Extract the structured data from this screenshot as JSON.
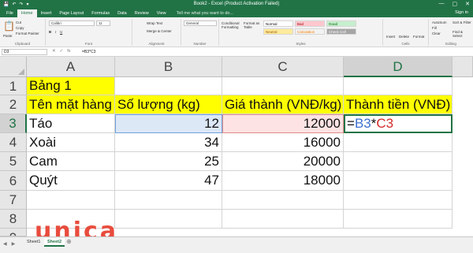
{
  "window": {
    "title": "Book2 - Excel (Product Activation Failed)",
    "qat": [
      "💾",
      "↶",
      "↷",
      "▾"
    ],
    "controls": [
      "—",
      "▢",
      "✕"
    ]
  },
  "ribbon_tabs": [
    "File",
    "Home",
    "Insert",
    "Page Layout",
    "Formulas",
    "Data",
    "Review",
    "View"
  ],
  "active_tab": "Home",
  "tell_me": "Tell me what you want to do...",
  "sign_in": "Sign in",
  "ribbon": {
    "clipboard": {
      "paste": "Paste",
      "cut": "Cut",
      "copy": "Copy",
      "painter": "Format Painter",
      "label": "Clipboard"
    },
    "font": {
      "name": "Calibri",
      "size": "11",
      "label": "Font"
    },
    "alignment": {
      "wrap": "Wrap Text",
      "merge": "Merge & Center",
      "label": "Alignment"
    },
    "number": {
      "format": "General",
      "label": "Number"
    },
    "styles": {
      "conditional": "Conditional Formatting",
      "format_table": "Format as Table",
      "normal": "Normal",
      "bad": "Bad",
      "good": "Good",
      "neutral": "Neutral",
      "calculation": "Calculation",
      "check_cell": "Check Cell",
      "label": "Styles"
    },
    "cells": {
      "insert": "Insert",
      "delete": "Delete",
      "format": "Format",
      "label": "Cells"
    },
    "editing": {
      "autosum": "AutoSum",
      "fill": "Fill",
      "clear": "Clear",
      "sort": "Sort & Filter",
      "find": "Find & Select",
      "label": "Editing"
    }
  },
  "formula_bar": {
    "name_box": "D3",
    "icons": [
      "✕",
      "✓",
      "fx"
    ],
    "formula": "=B3*C3"
  },
  "columns": [
    "A",
    "B",
    "C",
    "D"
  ],
  "rows": [
    "1",
    "2",
    "3",
    "4",
    "5",
    "6",
    "7",
    "8",
    "9"
  ],
  "cells": {
    "A1": "Bảng 1",
    "A2": "Tên mặt hàng",
    "B2": "Số lượng (kg)",
    "C2": "Giá thành (VNĐ/kg)",
    "D2": "Thành tiền (VNĐ)",
    "A3": "Táo",
    "B3": "12",
    "C3": "12000",
    "A4": "Xoài",
    "B4": "34",
    "C4": "16000",
    "A5": "Cam",
    "B5": "25",
    "C5": "20000",
    "A6": "Quýt",
    "B6": "47",
    "C6": "18000"
  },
  "edit_formula": {
    "eq": "=",
    "ref1": "B3",
    "op": "*",
    "ref2": "C3"
  },
  "sheets": [
    "Sheet1",
    "Sheet2"
  ],
  "active_sheet": "Sheet2",
  "add_sheet": "⊕",
  "sheet_nav": [
    "◀",
    "▶"
  ],
  "watermark": "unica",
  "colors": {
    "excel_green": "#217346",
    "header_yellow": "#ffff00",
    "ref_blue": "#3b6fd1",
    "ref_red": "#d22b2b",
    "logo": "#e84c3d"
  }
}
